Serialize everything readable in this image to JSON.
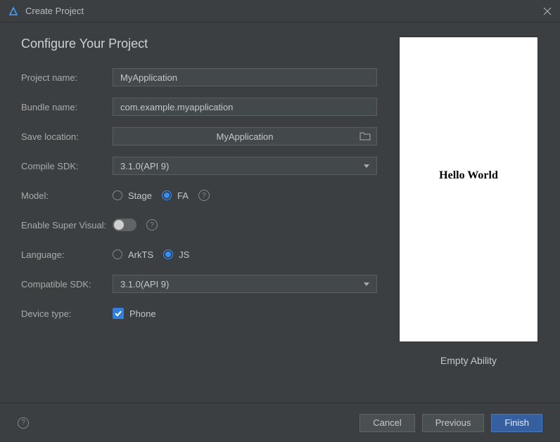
{
  "window": {
    "title": "Create Project"
  },
  "heading": "Configure Your Project",
  "labels": {
    "project_name": "Project name:",
    "bundle_name": "Bundle name:",
    "save_location": "Save location:",
    "compile_sdk": "Compile SDK:",
    "model": "Model:",
    "enable_super_visual": "Enable Super Visual:",
    "language": "Language:",
    "compatible_sdk": "Compatible SDK:",
    "device_type": "Device type:"
  },
  "fields": {
    "project_name": "MyApplication",
    "bundle_name": "com.example.myapplication",
    "save_location": "MyApplication",
    "compile_sdk": "3.1.0(API 9)",
    "compatible_sdk": "3.1.0(API 9)"
  },
  "model": {
    "option1": "Stage",
    "option2": "FA"
  },
  "language": {
    "option1": "ArkTS",
    "option2": "JS"
  },
  "device_type": {
    "phone": "Phone"
  },
  "preview": {
    "text": "Hello World",
    "label": "Empty Ability"
  },
  "buttons": {
    "cancel": "Cancel",
    "previous": "Previous",
    "finish": "Finish"
  }
}
